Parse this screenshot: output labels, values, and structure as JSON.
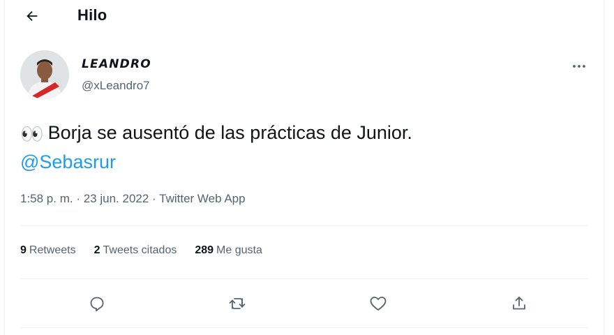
{
  "header": {
    "title": "Hilo",
    "back_icon": "arrow-left-icon"
  },
  "tweet": {
    "author": {
      "name": "LEANDRO",
      "handle": "@xLeandro7",
      "avatar": "avatar-photo"
    },
    "more_icon": "more-horizontal-icon",
    "text": {
      "emoji": "👀",
      "body": "Borja se ausentó de las prácticas de Junior.",
      "mention": "@Sebasrur"
    },
    "meta": {
      "time": "1:58 p. m.",
      "sep1": " · ",
      "date": "23 jun. 2022",
      "sep2": " · ",
      "source": "Twitter Web App"
    },
    "stats": [
      {
        "count": "9",
        "label": "Retweets"
      },
      {
        "count": "2",
        "label": "Tweets citados"
      },
      {
        "count": "289",
        "label": "Me gusta"
      }
    ],
    "actions": [
      {
        "icon": "reply-icon"
      },
      {
        "icon": "retweet-icon"
      },
      {
        "icon": "like-icon"
      },
      {
        "icon": "share-icon"
      }
    ]
  },
  "colors": {
    "accent": "#1d9bf0",
    "text": "#0f1419",
    "secondary": "#536471",
    "divider": "#eff3f4"
  }
}
